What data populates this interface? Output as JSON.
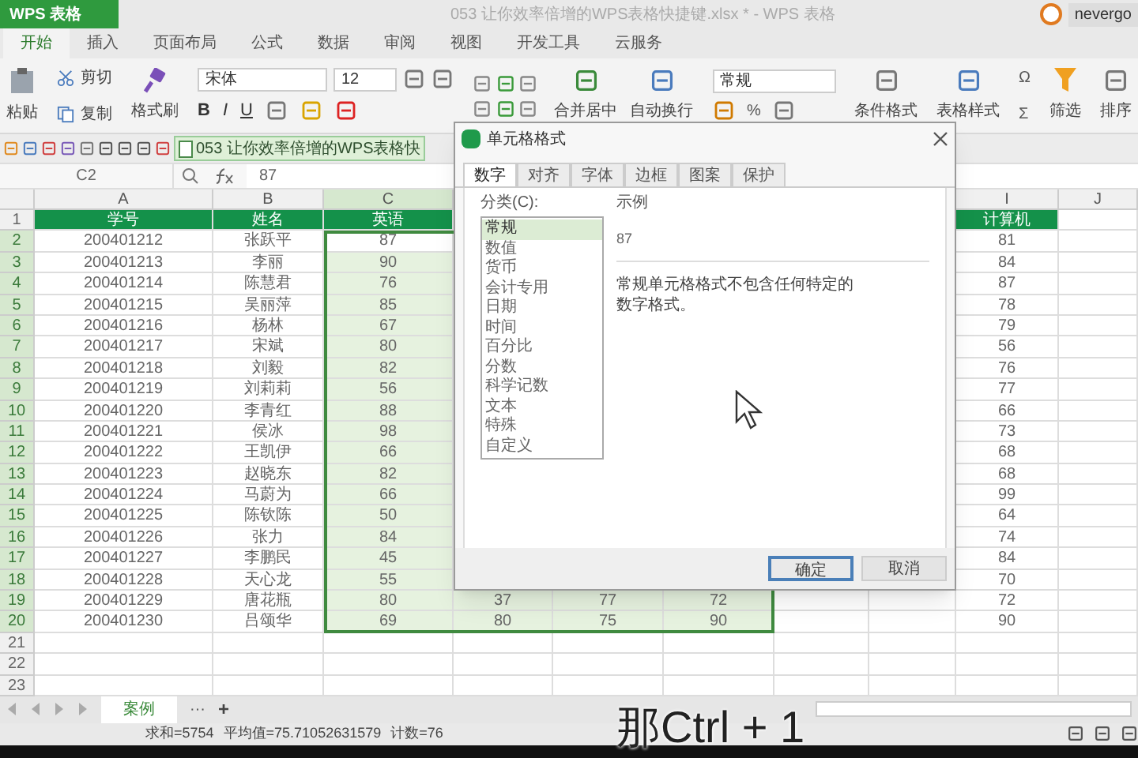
{
  "app": {
    "menu_button": "WPS 表格",
    "title": "053 让你效率倍增的WPS表格快捷键.xlsx * - WPS 表格",
    "user": "nevergo"
  },
  "tabs": [
    {
      "label": "开始",
      "selected": true
    },
    {
      "label": "插入",
      "selected": false
    },
    {
      "label": "页面布局",
      "selected": false
    },
    {
      "label": "公式",
      "selected": false
    },
    {
      "label": "数据",
      "selected": false
    },
    {
      "label": "审阅",
      "selected": false
    },
    {
      "label": "视图",
      "selected": false
    },
    {
      "label": "开发工具",
      "selected": false
    },
    {
      "label": "云服务",
      "selected": false
    }
  ],
  "ribbon": {
    "paste": "粘贴",
    "cut": "剪切",
    "copy": "复制",
    "format_painter": "格式刷",
    "font_name": "宋体",
    "font_size": "12",
    "bold": "B",
    "italic": "I",
    "underline": "U",
    "merge": "合并居中",
    "wrap": "自动换行",
    "number_format": "常规",
    "percent": "%",
    "conditional_format": "条件格式",
    "table_style": "表格样式",
    "symbol": "Ω",
    "sum": "Σ",
    "filter": "筛选",
    "sort": "排序"
  },
  "document_tab": "053 让你效率倍增的WPS表格快",
  "formula_bar": {
    "name_box": "C2",
    "value": "87"
  },
  "sheet": {
    "columns": [
      {
        "letter": "A",
        "selected": false
      },
      {
        "letter": "B",
        "selected": false
      },
      {
        "letter": "C",
        "selected": true
      },
      {
        "selected": true
      },
      {
        "selected": true
      },
      {
        "selected": true
      },
      {
        "selected": false
      },
      {
        "selected": false
      },
      {
        "letter": "I",
        "selected": false
      },
      {
        "letter": "J",
        "selected": false
      }
    ],
    "rows": [
      {
        "number": "1",
        "kind": "header",
        "selected": false,
        "cells": [
          "学号",
          "姓名",
          "英语",
          null,
          null,
          null,
          null,
          null,
          "计算机",
          null
        ]
      },
      {
        "number": "2",
        "kind": "data",
        "selected": true,
        "active": true,
        "cells": [
          "200401212",
          "张跃平",
          "87",
          null,
          null,
          null,
          null,
          null,
          "81",
          null
        ]
      },
      {
        "number": "3",
        "kind": "data",
        "selected": true,
        "cells": [
          "200401213",
          "李丽",
          "90",
          null,
          null,
          null,
          null,
          null,
          "84",
          null
        ]
      },
      {
        "number": "4",
        "kind": "data",
        "selected": true,
        "cells": [
          "200401214",
          "陈慧君",
          "76",
          null,
          null,
          null,
          null,
          null,
          "87",
          null
        ]
      },
      {
        "number": "5",
        "kind": "data",
        "selected": true,
        "cells": [
          "200401215",
          "吴丽萍",
          "85",
          null,
          null,
          null,
          null,
          null,
          "78",
          null
        ]
      },
      {
        "number": "6",
        "kind": "data",
        "selected": true,
        "cells": [
          "200401216",
          "杨林",
          "67",
          null,
          null,
          null,
          null,
          null,
          "79",
          null
        ]
      },
      {
        "number": "7",
        "kind": "data",
        "selected": true,
        "cells": [
          "200401217",
          "宋斌",
          "80",
          null,
          null,
          null,
          null,
          null,
          "56",
          null
        ]
      },
      {
        "number": "8",
        "kind": "data",
        "selected": true,
        "cells": [
          "200401218",
          "刘毅",
          "82",
          null,
          null,
          null,
          null,
          null,
          "76",
          null
        ]
      },
      {
        "number": "9",
        "kind": "data",
        "selected": true,
        "cells": [
          "200401219",
          "刘莉莉",
          "56",
          null,
          null,
          null,
          null,
          null,
          "77",
          null
        ]
      },
      {
        "number": "10",
        "kind": "data",
        "selected": true,
        "cells": [
          "200401220",
          "李青红",
          "88",
          null,
          null,
          null,
          null,
          null,
          "66",
          null
        ]
      },
      {
        "number": "11",
        "kind": "data",
        "selected": true,
        "cells": [
          "200401221",
          "侯冰",
          "98",
          null,
          null,
          null,
          null,
          null,
          "73",
          null
        ]
      },
      {
        "number": "12",
        "kind": "data",
        "selected": true,
        "cells": [
          "200401222",
          "王凯伊",
          "66",
          null,
          null,
          null,
          null,
          null,
          "68",
          null
        ]
      },
      {
        "number": "13",
        "kind": "data",
        "selected": true,
        "cells": [
          "200401223",
          "赵晓东",
          "82",
          null,
          null,
          null,
          null,
          null,
          "68",
          null
        ]
      },
      {
        "number": "14",
        "kind": "data",
        "selected": true,
        "cells": [
          "200401224",
          "马蔚为",
          "66",
          null,
          null,
          null,
          null,
          null,
          "99",
          null
        ]
      },
      {
        "number": "15",
        "kind": "data",
        "selected": true,
        "cells": [
          "200401225",
          "陈钦陈",
          "50",
          null,
          null,
          null,
          null,
          null,
          "64",
          null
        ]
      },
      {
        "number": "16",
        "kind": "data",
        "selected": true,
        "cells": [
          "200401226",
          "张力",
          "84",
          null,
          null,
          null,
          null,
          null,
          "74",
          null
        ]
      },
      {
        "number": "17",
        "kind": "data",
        "selected": true,
        "cells": [
          "200401227",
          "李鹏民",
          "45",
          null,
          null,
          null,
          null,
          null,
          "84",
          null
        ]
      },
      {
        "number": "18",
        "kind": "data",
        "selected": true,
        "cells": [
          "200401228",
          "天心龙",
          "55",
          null,
          null,
          null,
          null,
          null,
          "70",
          null
        ]
      },
      {
        "number": "19",
        "kind": "data",
        "selected": true,
        "cells": [
          "200401229",
          "唐花瓶",
          "80",
          "37",
          "77",
          "72",
          null,
          null,
          "72",
          null
        ]
      },
      {
        "number": "20",
        "kind": "data",
        "selected": true,
        "cells": [
          "200401230",
          "吕颂华",
          "69",
          "80",
          "75",
          "90",
          null,
          null,
          "90",
          null
        ]
      },
      {
        "number": "21",
        "kind": "data",
        "selected": false,
        "cells": [
          null,
          null,
          null,
          null,
          null,
          null,
          null,
          null,
          null,
          null
        ]
      },
      {
        "number": "22",
        "kind": "data",
        "selected": false,
        "cells": [
          null,
          null,
          null,
          null,
          null,
          null,
          null,
          null,
          null,
          null
        ]
      },
      {
        "number": "23",
        "kind": "data",
        "selected": false,
        "cells": [
          null,
          null,
          null,
          null,
          null,
          null,
          null,
          null,
          null,
          null
        ]
      }
    ]
  },
  "dialog": {
    "title": "单元格格式",
    "tabs": [
      {
        "label": "数字",
        "selected": true
      },
      {
        "label": "对齐",
        "selected": false
      },
      {
        "label": "字体",
        "selected": false
      },
      {
        "label": "边框",
        "selected": false
      },
      {
        "label": "图案",
        "selected": false
      },
      {
        "label": "保护",
        "selected": false
      }
    ],
    "category_label": "分类(C):",
    "categories": [
      {
        "label": "常规",
        "selected": true
      },
      {
        "label": "数值",
        "selected": false
      },
      {
        "label": "货币",
        "selected": false
      },
      {
        "label": "会计专用",
        "selected": false
      },
      {
        "label": "日期",
        "selected": false
      },
      {
        "label": "时间",
        "selected": false
      },
      {
        "label": "百分比",
        "selected": false
      },
      {
        "label": "分数",
        "selected": false
      },
      {
        "label": "科学记数",
        "selected": false
      },
      {
        "label": "文本",
        "selected": false
      },
      {
        "label": "特殊",
        "selected": false
      },
      {
        "label": "自定义",
        "selected": false
      }
    ],
    "sample_label": "示例",
    "sample_value": "87",
    "description": "常规单元格格式不包含任何特定的数字格式。",
    "buttons": [
      {
        "label": "确定",
        "kind": "primary"
      },
      {
        "label": "取消",
        "kind": "secondary"
      }
    ]
  },
  "sheet_tabs": [
    {
      "label": "案例",
      "selected": true
    }
  ],
  "sheet_tab_more": "···",
  "sheet_tab_add": "+",
  "status": [
    "求和=5754",
    "平均值=75.71052631579",
    "计数=76"
  ],
  "caption": "那Ctrl + 1"
}
